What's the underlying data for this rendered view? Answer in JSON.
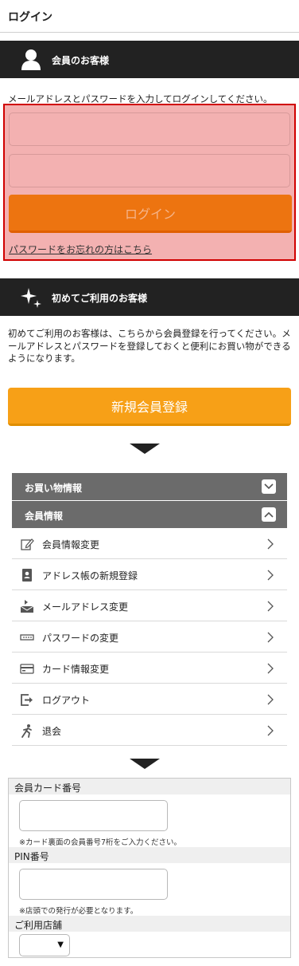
{
  "page": {
    "title": "ログイン"
  },
  "member_section": {
    "heading": "会員のお客様",
    "icon": "person-icon",
    "intro": "メールアドレスとパスワードを入力してログインしてください。",
    "email_placeholder": "",
    "password_placeholder": "",
    "login_button": "ログイン",
    "forgot_link": "パスワードをお忘れの方はこちら"
  },
  "new_section": {
    "heading": "初めてご利用のお客様",
    "icon": "sparkle-icon",
    "text": "初めてご利用のお客様は、こちらから会員登録を行ってください。メールアドレスとパスワードを登録しておくと便利にお買い物ができるようになります。",
    "register_button": "新規会員登録"
  },
  "accordion": {
    "shopping": {
      "label": "お買い物情報",
      "state": "collapsed"
    },
    "member": {
      "label": "会員情報",
      "state": "expanded"
    }
  },
  "menu": [
    {
      "label": "会員情報変更",
      "icon": "edit-icon"
    },
    {
      "label": "アドレス帳の新規登録",
      "icon": "address-book-icon"
    },
    {
      "label": "メールアドレス変更",
      "icon": "mail-change-icon"
    },
    {
      "label": "パスワードの変更",
      "icon": "password-icon"
    },
    {
      "label": "カード情報変更",
      "icon": "card-icon"
    },
    {
      "label": "ログアウト",
      "icon": "logout-icon"
    },
    {
      "label": "退会",
      "icon": "running-person-icon"
    }
  ],
  "card_form": {
    "card_number_label": "会員カード番号",
    "card_number_note": "※カード裏面の会員番号7桁をご入力ください。",
    "pin_label": "PIN番号",
    "pin_note": "※店頭での発行が必要となります。",
    "store_label": "ご利用店舗",
    "store_selected": ""
  },
  "colors": {
    "header_bg": "#222222",
    "login_button": "#ed7410",
    "register_button": "#f7a017",
    "highlight_border": "#d00000",
    "highlight_fill": "#f3b1b1",
    "accordion_bg": "#6b6b6b"
  }
}
